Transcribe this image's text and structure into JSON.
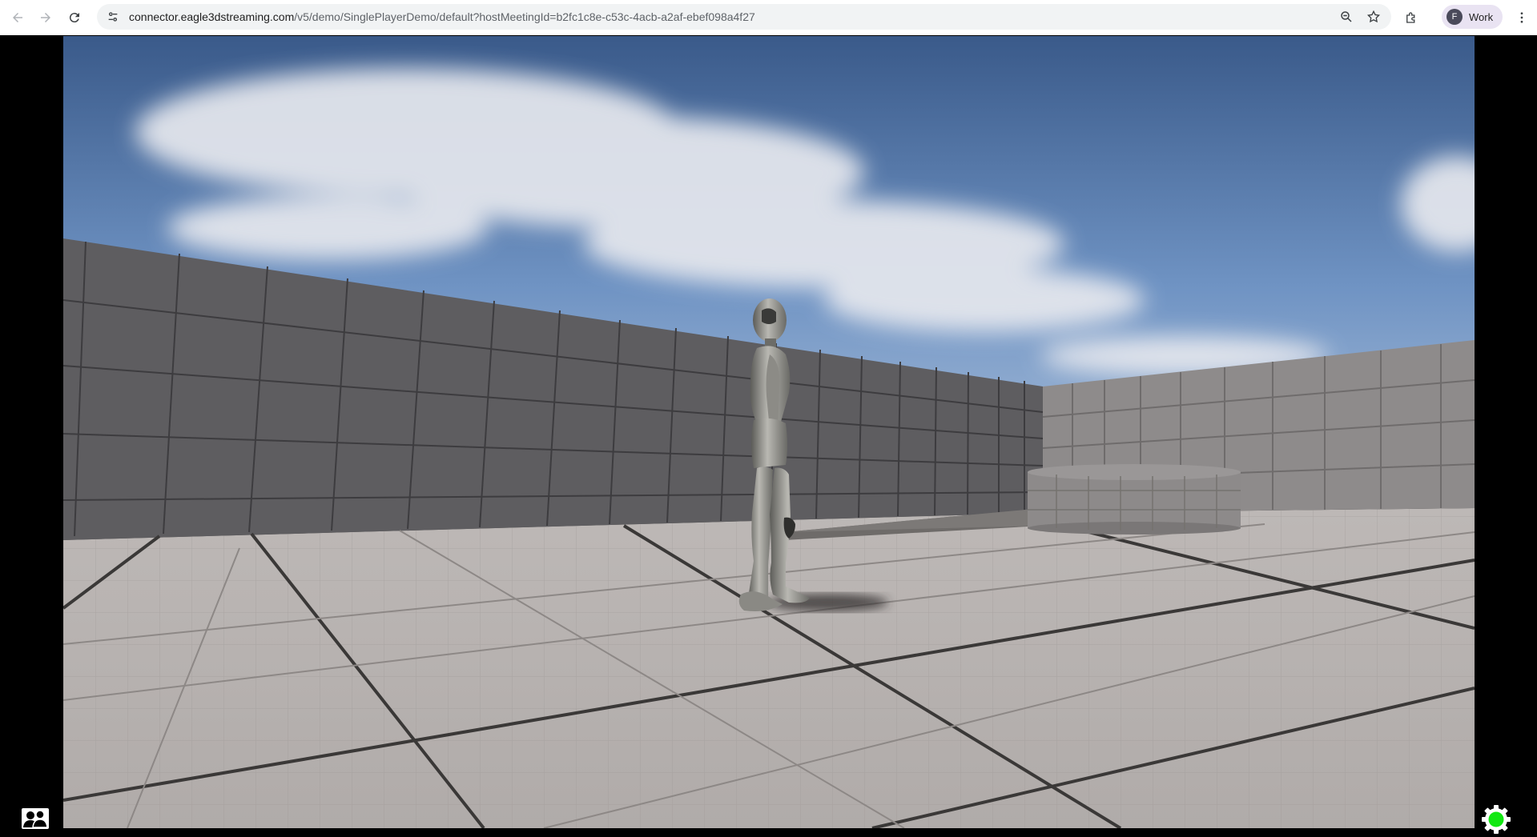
{
  "browser": {
    "url_host": "connector.eagle3dstreaming.com",
    "url_path": "/v5/demo/SinglePlayerDemo/default?hostMeetingId=b2fc1c8e-c53c-4acb-a2af-ebef098a4f27",
    "profile_initial": "F",
    "profile_label": "Work",
    "icons": {
      "back": "arrow-left-icon",
      "forward": "arrow-right-icon",
      "reload": "reload-icon",
      "site_info": "tune-icon",
      "zoom": "zoom-icon",
      "bookmark": "star-icon",
      "extensions": "puzzle-icon",
      "menu": "kebab-menu-icon"
    }
  },
  "stream": {
    "scene_description_hidden": "",
    "controls": {
      "participants_icon": "users-icon",
      "settings_icon": "gear-icon",
      "settings_status_color": "#12e812"
    }
  },
  "colors": {
    "sky_top": "#3e5f8f",
    "sky_bottom": "#7ea1cc",
    "wall": "#5e5d5f",
    "wall_light": "#8f8c8c",
    "floor": "#b5b1af"
  }
}
